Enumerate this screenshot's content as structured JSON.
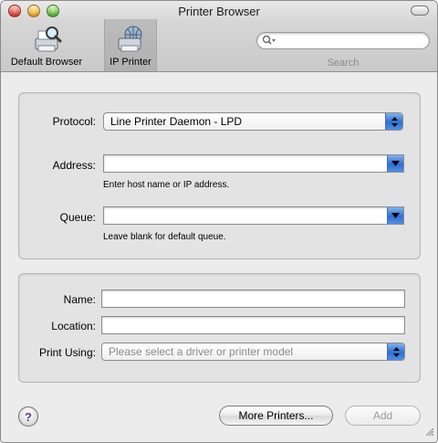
{
  "window": {
    "title": "Printer Browser"
  },
  "toolbar": {
    "default_browser_label": "Default Browser",
    "ip_printer_label": "IP Printer",
    "search_label": "Search",
    "search_placeholder": ""
  },
  "printer_settings": {
    "protocol_label": "Protocol:",
    "protocol_value": "Line Printer Daemon - LPD",
    "address_label": "Address:",
    "address_value": "",
    "address_hint": "Enter host name or IP address.",
    "queue_label": "Queue:",
    "queue_value": "",
    "queue_hint": "Leave blank for default queue."
  },
  "printer_info": {
    "name_label": "Name:",
    "name_value": "",
    "location_label": "Location:",
    "location_value": "",
    "print_using_label": "Print Using:",
    "print_using_value": "Please select a driver or printer model"
  },
  "footer": {
    "help_label": "?",
    "more_printers_label": "More Printers...",
    "add_label": "Add"
  },
  "colors": {
    "accent": "#2f6fd4",
    "window_bg": "#ececec",
    "disabled_text": "#9a9a9a"
  },
  "icons": {
    "default_browser": "printer-magnifier-icon",
    "ip_printer": "printer-globe-icon",
    "search": "magnifier-icon",
    "help": "question-mark-icon"
  }
}
